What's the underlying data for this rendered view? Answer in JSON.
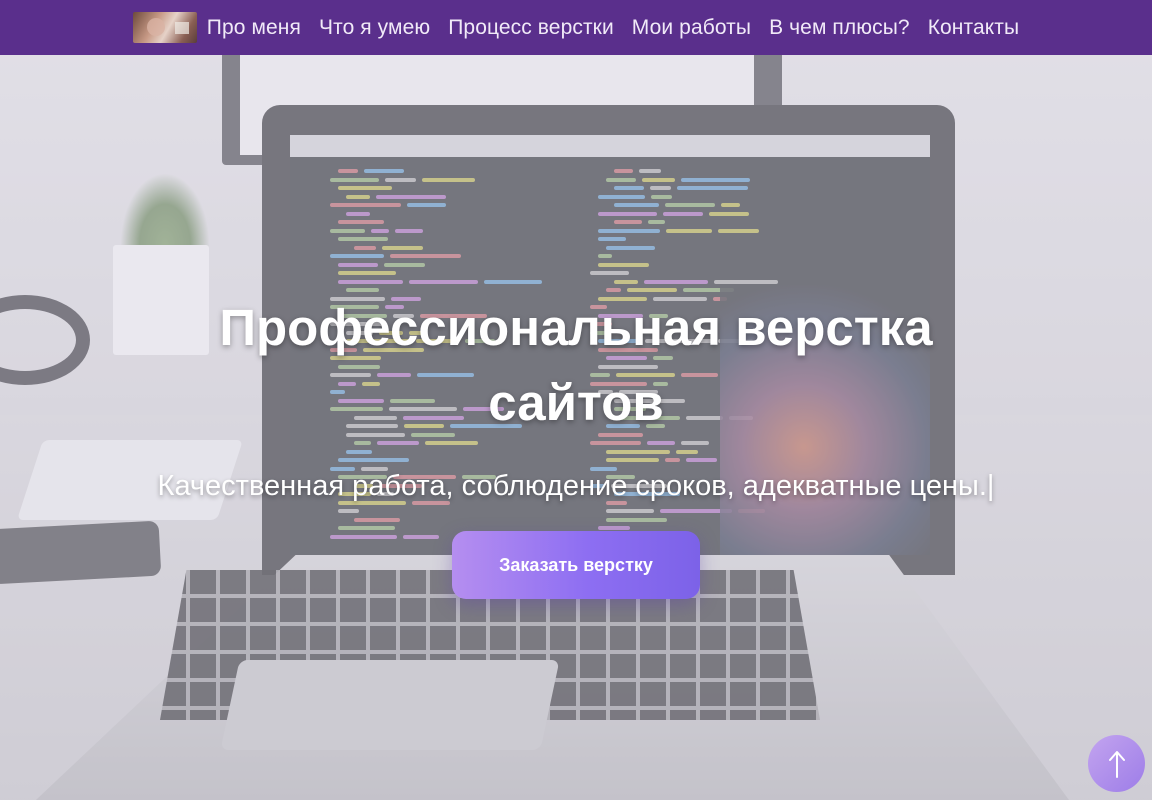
{
  "nav": {
    "logo_icon": "profile-photo-logo",
    "items": [
      {
        "label": "Про меня"
      },
      {
        "label": "Что я умею"
      },
      {
        "label": "Процесс верстки"
      },
      {
        "label": "Мои работы"
      },
      {
        "label": "В чем плюсы?"
      },
      {
        "label": "Контакты"
      }
    ],
    "background_color": "#5a2f8c"
  },
  "hero": {
    "title_line1": "Профессиональная верстка",
    "title_line2": "сайтов",
    "subtitle": "Качественная работа, соблюдение сроков, адекватные цены.",
    "cursor": "|",
    "cta_label": "Заказать верстку",
    "background_image": "laptop-with-code-editor-photo",
    "cta_gradient": [
      "#b58ef0",
      "#7c62e8"
    ]
  },
  "scroll_top": {
    "icon": "arrow-up-icon"
  }
}
